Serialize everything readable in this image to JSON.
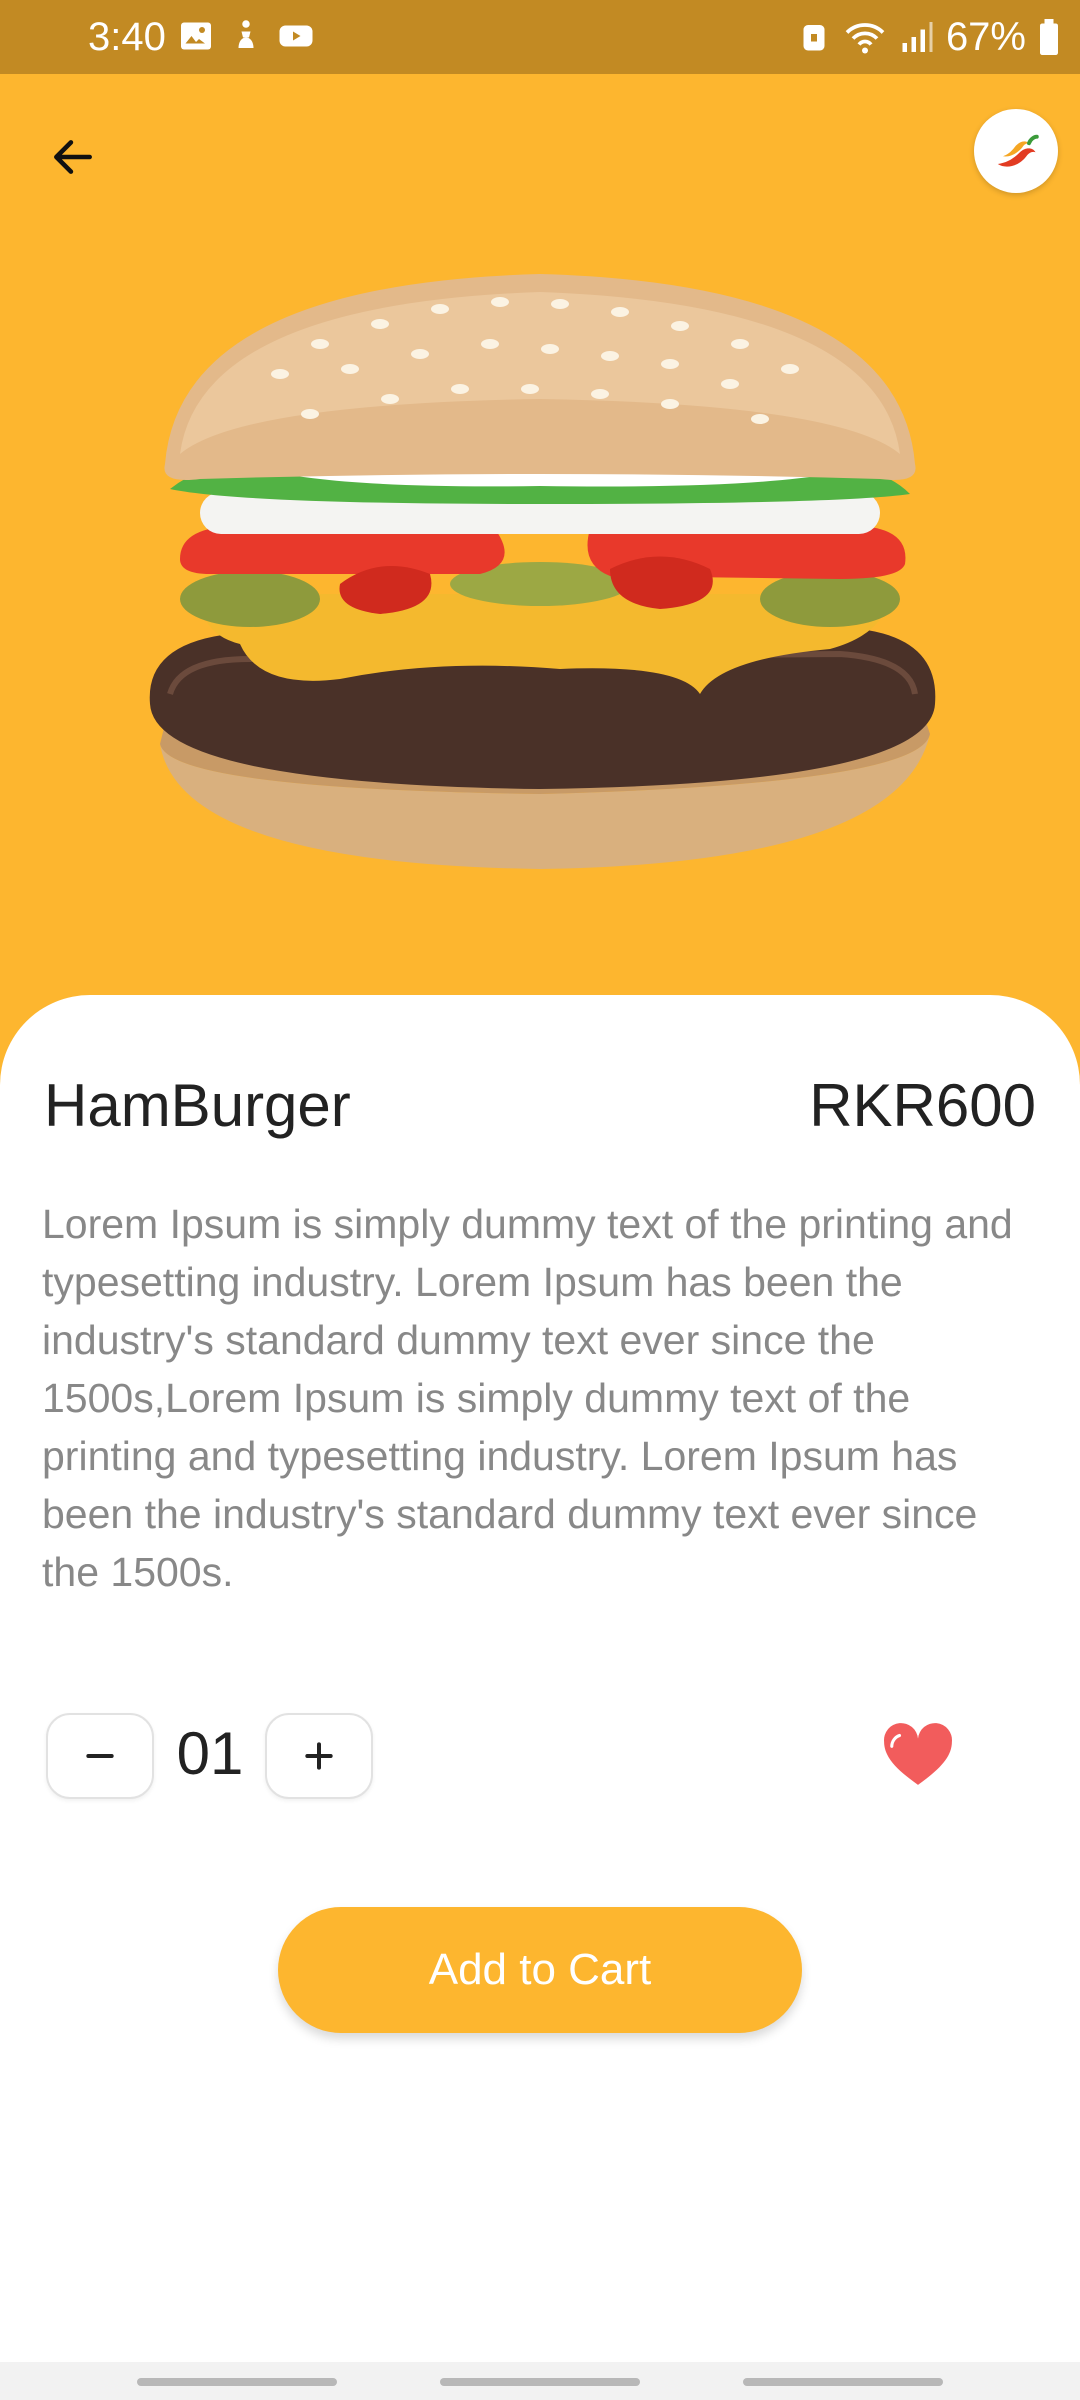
{
  "status_bar": {
    "time": "3:40",
    "battery": "67%",
    "icons_left": [
      "gallery-icon",
      "accessibility-icon",
      "youtube-icon"
    ],
    "icons_right": [
      "lock-icon",
      "wifi-icon",
      "signal-icon",
      "battery-icon"
    ]
  },
  "header": {
    "back_icon": "arrow-left-icon",
    "logo_icon": "chili-pepper-icon"
  },
  "product": {
    "name": "HamBurger",
    "price": "RKR600",
    "description": "Lorem Ipsum is simply dummy text of the printing and typesetting industry. Lorem Ipsum has been the industry's standard dummy text ever since the 1500s,Lorem Ipsum is simply dummy text of the printing and typesetting industry. Lorem Ipsum has been the industry's standard dummy text ever since the 1500s."
  },
  "quantity": {
    "minus_label": "–",
    "value": "01",
    "plus_label": "+"
  },
  "favorite": {
    "icon": "heart-icon",
    "color": "#F25C5C"
  },
  "cart": {
    "label": "Add to Cart"
  },
  "colors": {
    "accent": "#FDB62F",
    "status_bar": "#C28A23",
    "heart": "#F25C5C"
  }
}
